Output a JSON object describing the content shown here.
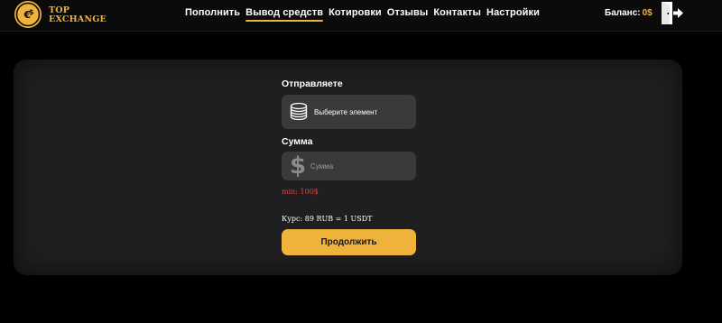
{
  "header": {
    "logo": {
      "line1": "TOP",
      "line2": "EXCHANGE",
      "icon": "euro-dollar-coin-icon"
    },
    "nav": [
      {
        "label": "Пополнить",
        "active": false
      },
      {
        "label": "Вывод средств",
        "active": true
      },
      {
        "label": "Котировки",
        "active": false
      },
      {
        "label": "Отзывы",
        "active": false
      },
      {
        "label": "Контакты",
        "active": false
      },
      {
        "label": "Настройки",
        "active": false
      }
    ],
    "balance": {
      "label": "Баланс:",
      "value": "0$"
    },
    "logout_icon": "logout-door-icon"
  },
  "form": {
    "send_label": "Отправляете",
    "select": {
      "icon": "coins-stack-icon",
      "text": "Выберите элемент"
    },
    "amount_label": "Сумма",
    "amount": {
      "icon": "dollar-icon",
      "symbol": "$",
      "placeholder": "Сумма",
      "value": ""
    },
    "min_text": "min: 100$",
    "rate_text": "Курс: 89 RUB = 1 USDT",
    "continue_label": "Продолжить"
  },
  "colors": {
    "accent": "#efb23b",
    "error": "#e0403a",
    "background": "#000000",
    "card": "#1f1f21",
    "field": "#3a3a3c"
  }
}
